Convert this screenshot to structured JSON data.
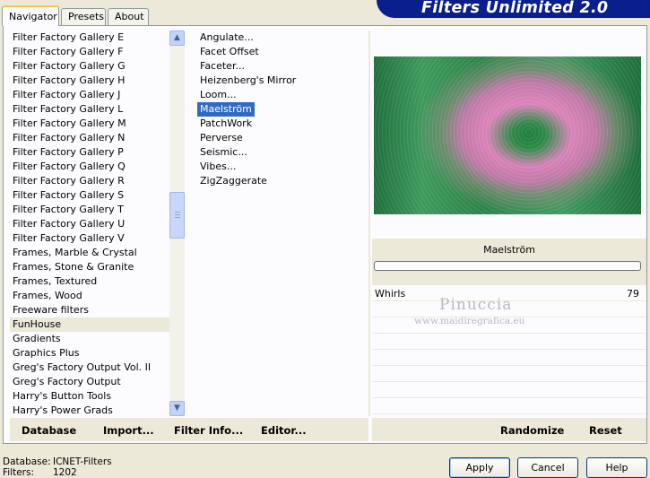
{
  "window": {
    "title": "Filters Unlimited 2.0",
    "tabs": [
      {
        "label": "Navigator",
        "active": true
      },
      {
        "label": "Presets",
        "active": false
      },
      {
        "label": "About",
        "active": false
      }
    ]
  },
  "categories": {
    "items": [
      "Filter Factory Gallery E",
      "Filter Factory Gallery F",
      "Filter Factory Gallery G",
      "Filter Factory Gallery H",
      "Filter Factory Gallery J",
      "Filter Factory Gallery L",
      "Filter Factory Gallery M",
      "Filter Factory Gallery N",
      "Filter Factory Gallery P",
      "Filter Factory Gallery Q",
      "Filter Factory Gallery R",
      "Filter Factory Gallery S",
      "Filter Factory Gallery T",
      "Filter Factory Gallery U",
      "Filter Factory Gallery V",
      "Frames, Marble & Crystal",
      "Frames, Stone & Granite",
      "Frames, Textured",
      "Frames, Wood",
      "Freeware filters",
      "FunHouse",
      "Gradients",
      "Graphics Plus",
      "Greg's Factory Output Vol. II",
      "Greg's Factory Output",
      "Harry's Button Tools",
      "Harry's Power Grads"
    ],
    "selected": "FunHouse"
  },
  "filters": {
    "items": [
      "Angulate...",
      "Facet Offset",
      "Faceter...",
      "Heizenberg's Mirror",
      "Loom...",
      "Maelström",
      "PatchWork",
      "Perverse",
      "Seismic...",
      "Vibes...",
      "ZigZaggerate"
    ],
    "selected": "Maelström"
  },
  "preview": {
    "filter_name": "Maelström",
    "colors": {
      "green": "#2c8448",
      "pink": "#e08fbf"
    }
  },
  "params": [
    {
      "label": "Whirls",
      "value": "79"
    }
  ],
  "watermark": {
    "name": "Pinuccia",
    "url": "www.maidiregrafica.eu"
  },
  "left_bar": {
    "database": "Database",
    "import": "Import...",
    "filter_info": "Filter Info...",
    "editor": "Editor..."
  },
  "right_bar": {
    "randomize": "Randomize",
    "reset": "Reset"
  },
  "footer": {
    "database_label": "Database:",
    "database_value": "ICNET-Filters",
    "filters_label": "Filters:",
    "filters_value": "1202"
  },
  "buttons": {
    "apply": "Apply",
    "cancel": "Cancel",
    "help": "Help"
  },
  "theme": {
    "selection": "#316ac5",
    "banner": "#0a1e8c",
    "face": "#ece9d8"
  }
}
